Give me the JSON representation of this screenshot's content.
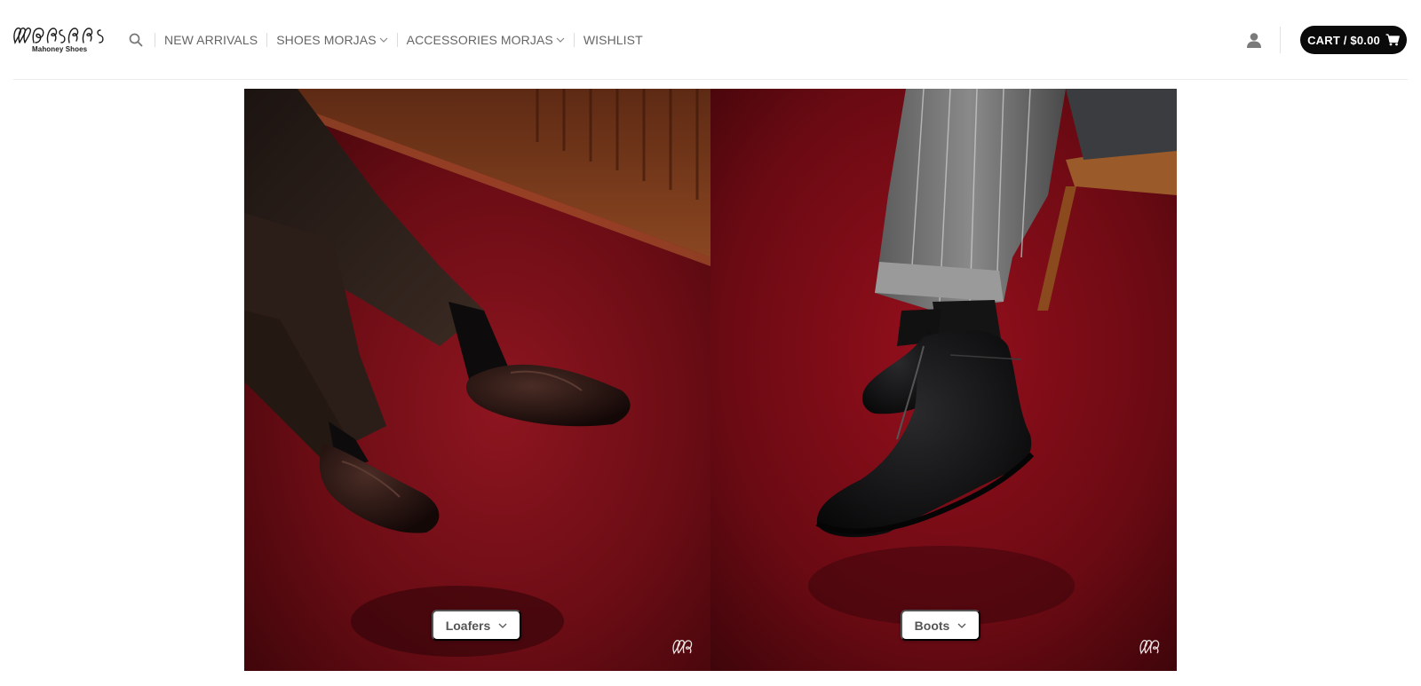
{
  "brand": {
    "logo_tagline": "Mahoney Shoes"
  },
  "nav": {
    "items": [
      {
        "label": "NEW ARRIVALS",
        "has_dropdown": false
      },
      {
        "label": "SHOES MORJAS",
        "has_dropdown": true
      },
      {
        "label": "ACCESSORIES MORJAS",
        "has_dropdown": true
      },
      {
        "label": "WISHLIST",
        "has_dropdown": false
      }
    ]
  },
  "header_actions": {
    "cart_label": "CART / $0.00",
    "cart_icon": "shopping-cart-icon",
    "account_icon": "user-icon",
    "search_icon": "search-icon"
  },
  "categories": [
    {
      "label": "Loafers",
      "watermark": "morjas-monogram"
    },
    {
      "label": "Boots",
      "watermark": "morjas-monogram"
    }
  ],
  "colors": {
    "cart_bg": "#0a0a0a",
    "carpet_red": "#7a0d16",
    "nav_text": "#666666"
  }
}
